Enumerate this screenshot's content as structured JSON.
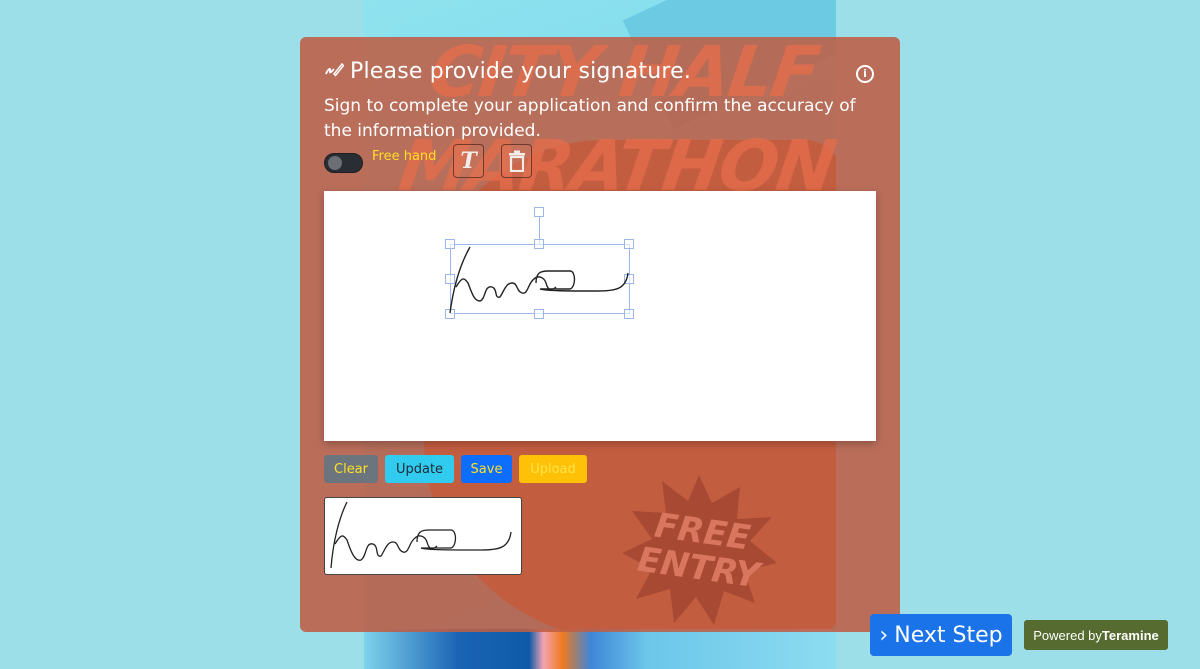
{
  "background": {
    "poster_headline_line1": "CITY HALF",
    "poster_headline_line2": "MARATHON",
    "poster_badge_line1": "FREE",
    "poster_badge_line2": "ENTRY"
  },
  "dialog": {
    "title_icon": "pen-signature-icon",
    "title": "Please provide your signature.",
    "info_icon": "info-circle-icon",
    "info_glyph": "i",
    "subtitle": "Sign to complete your application and confirm the accuracy of the information provided.",
    "toolbar": {
      "freehand_toggle_on": false,
      "freehand_label": "Free hand",
      "text_tool_glyph": "T",
      "text_tool_icon": "text-tool-icon",
      "delete_tool_icon": "trash-icon"
    },
    "canvas": {
      "signature_text": "hena",
      "selected": true
    },
    "buttons": {
      "clear": "Clear",
      "update": "Update",
      "save": "Save",
      "upload": "Upload"
    },
    "preview": {
      "signature_text": "hena"
    }
  },
  "footer": {
    "next_step_chevron": "›",
    "next_step": "Next Step",
    "powered_by_prefix": "Powered by",
    "powered_by_brand": "Teramine"
  },
  "colors": {
    "page_bg": "#9cdfe9",
    "card_bg": "#be5f46",
    "freehand_label": "#ffe027",
    "next_step_bg": "#1a73e8",
    "powered_bg": "#556b2f",
    "clear_bg": "#6c757d",
    "update_bg": "#31cbf0",
    "save_bg": "#0d6efd",
    "upload_bg": "#ffc107"
  }
}
